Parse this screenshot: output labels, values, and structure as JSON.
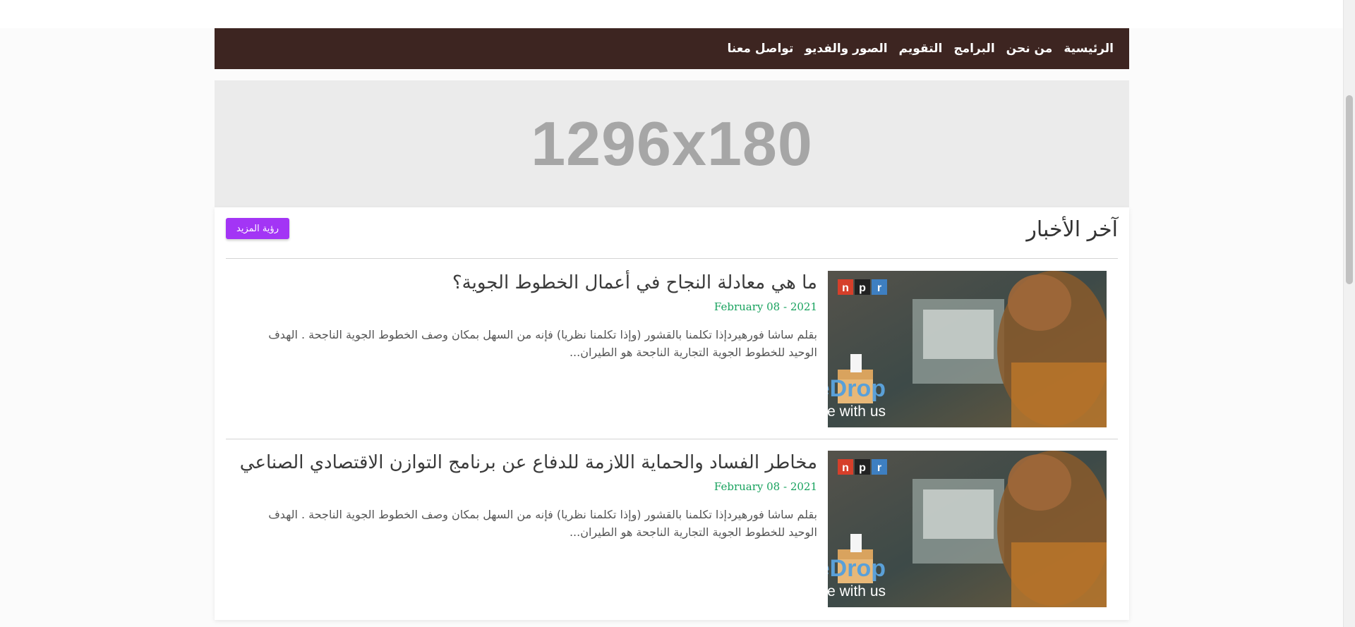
{
  "nav": {
    "items": [
      "الرئيسية",
      "من نحن",
      "البرامج",
      "التقويم",
      "الصور والفديو",
      "تواصل معنا"
    ]
  },
  "banner": {
    "text": "1296x180"
  },
  "news": {
    "title": "آخر الأخبار",
    "more_label": "رؤية المزيد",
    "articles": [
      {
        "title": "ما هي معادلة النجاح في أعمال الخطوط الجوية؟",
        "date": "February 08 - 2021",
        "excerpt": "بقلم ساشا فورهيردإذا تكلمنا بالقشور (وإذا تكلمنا نظريا) فإنه من السهل بمكان وصف الخطوط الجوية الناجحة . الهدف الوحيد للخطوط الجوية التجارية الناجحة هو الطيران...",
        "image": {
          "brand": "SecureDrop",
          "tagline": "Your story is safe with us.",
          "logo_letters": [
            "n",
            "p",
            "r"
          ]
        }
      },
      {
        "title": "مخاطر الفساد والحماية اللازمة للدفاع عن برنامج التوازن الاقتصادي الصناعي",
        "date": "February 08 - 2021",
        "excerpt": "بقلم ساشا فورهيردإذا تكلمنا بالقشور (وإذا تكلمنا نظريا) فإنه من السهل بمكان وصف الخطوط الجوية الناجحة . الهدف الوحيد للخطوط الجوية التجارية الناجحة هو الطيران...",
        "image": {
          "brand": "SecureDrop",
          "tagline": "Your story is safe with us.",
          "logo_letters": [
            "n",
            "p",
            "r"
          ]
        }
      }
    ]
  },
  "colors": {
    "navbar": "#3d2521",
    "button": "#a335f5",
    "date": "#18a25e",
    "banner_bg": "#ebebeb"
  }
}
